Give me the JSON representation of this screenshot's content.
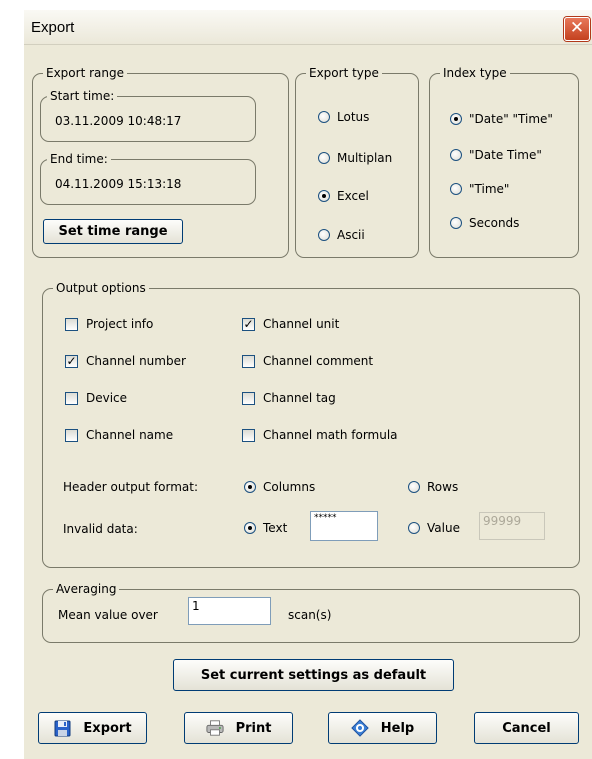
{
  "window": {
    "title": "Export",
    "close_glyph": "✕"
  },
  "export_range": {
    "label": "Export range",
    "start_label": "Start time:",
    "start_value": "03.11.2009 10:48:17",
    "end_label": "End time:",
    "end_value": "04.11.2009 15:13:18",
    "set_button": "Set time range"
  },
  "export_type": {
    "label": "Export type",
    "options": [
      "Lotus",
      "Multiplan",
      "Excel",
      "Ascii"
    ],
    "selected": "Excel"
  },
  "index_type": {
    "label": "Index type",
    "options": [
      "\"Date\" \"Time\"",
      "\"Date Time\"",
      "\"Time\"",
      "Seconds"
    ],
    "selected": "\"Date\" \"Time\""
  },
  "output_options": {
    "label": "Output options",
    "checkboxes": [
      {
        "label": "Project info",
        "checked": false
      },
      {
        "label": "Channel unit",
        "checked": true
      },
      {
        "label": "Channel number",
        "checked": true
      },
      {
        "label": "Channel comment",
        "checked": false
      },
      {
        "label": "Device",
        "checked": false
      },
      {
        "label": "Channel tag",
        "checked": false
      },
      {
        "label": "Channel name",
        "checked": false
      },
      {
        "label": "Channel math formula",
        "checked": false
      }
    ],
    "header_format_label": "Header output format:",
    "header_columns": "Columns",
    "header_rows": "Rows",
    "header_selected": "Columns",
    "invalid_label": "Invalid data:",
    "invalid_text": "Text",
    "invalid_text_value": "*****",
    "invalid_value": "Value",
    "invalid_value_value": "99999",
    "invalid_selected": "Text"
  },
  "averaging": {
    "label": "Averaging",
    "mean_label": "Mean value over",
    "mean_value": "1",
    "unit": "scan(s)"
  },
  "buttons": {
    "default": "Set current settings as default",
    "export": "Export",
    "print": "Print",
    "help": "Help",
    "cancel": "Cancel"
  },
  "icons": {
    "export": "floppy-disk-icon",
    "print": "printer-icon",
    "help": "help-icon"
  },
  "colors": {
    "window_bg": "#ece9d8",
    "close_red": "#d4502e",
    "border_blue": "#003c74"
  }
}
